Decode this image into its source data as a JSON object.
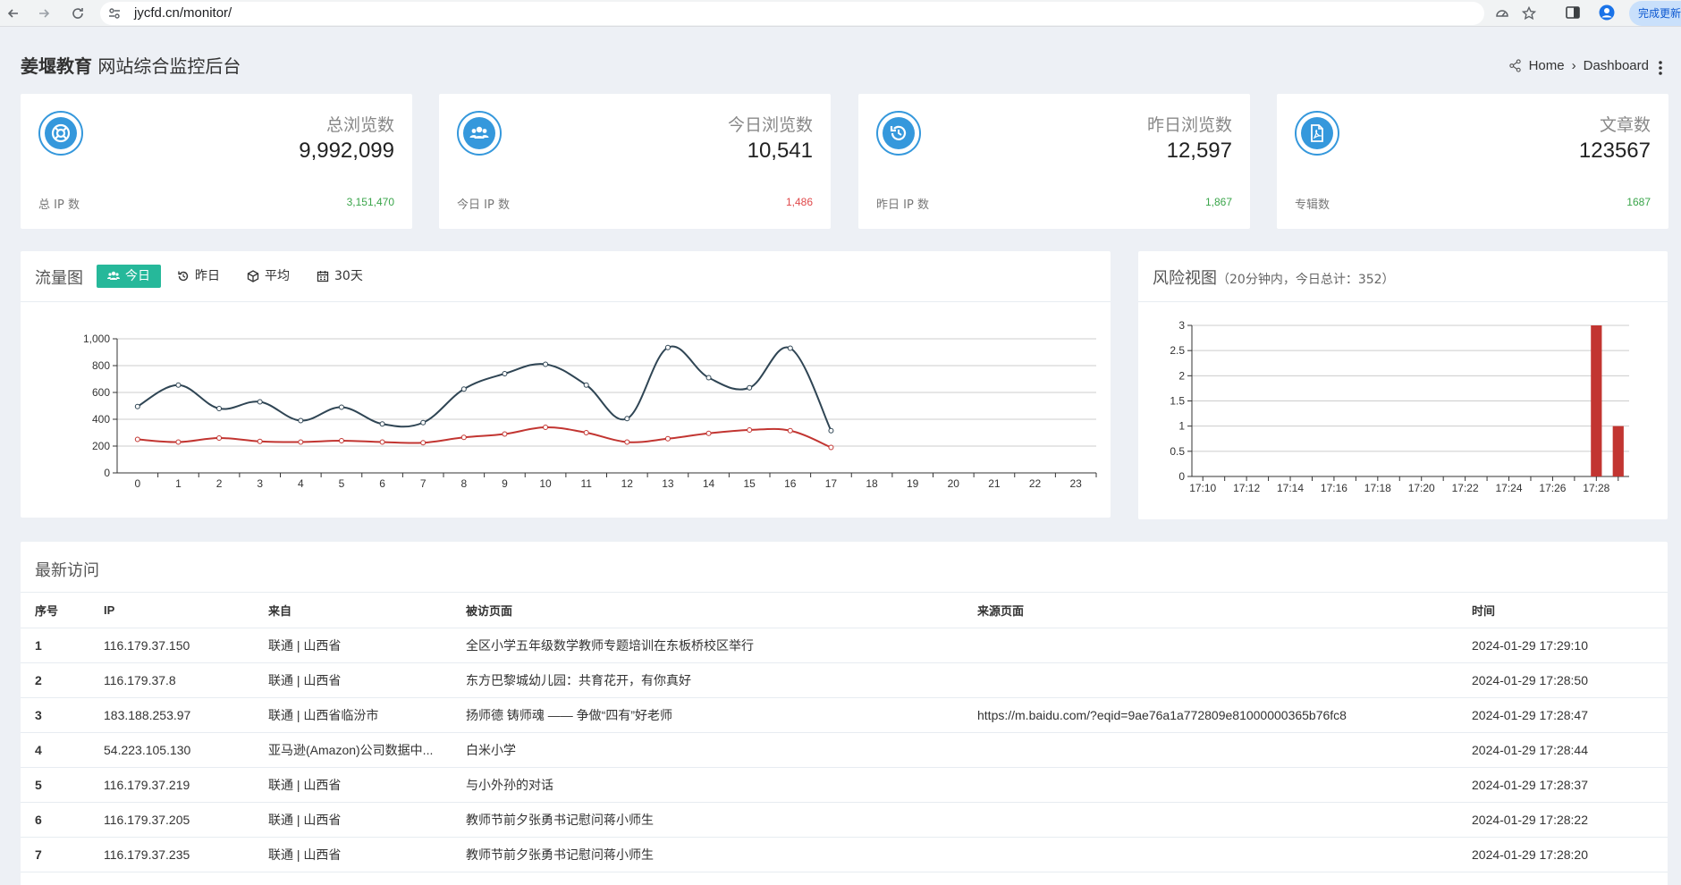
{
  "browser": {
    "url": "jycfd.cn/monitor/",
    "update_label": "完成更新"
  },
  "header": {
    "title_bold": "姜堰教育",
    "title_rest": " 网站综合监控后台",
    "breadcrumb": [
      "Home",
      "Dashboard"
    ]
  },
  "stats": [
    {
      "icon": "lifebuoy-icon",
      "label": "总浏览数",
      "value": "9,992,099",
      "sub_label": "总 IP 数",
      "sub_value": "3,151,470",
      "sub_color": "#3aa54a"
    },
    {
      "icon": "users-icon",
      "label": "今日浏览数",
      "value": "10,541",
      "sub_label": "今日 IP 数",
      "sub_value": "1,486",
      "sub_color": "#e0494b"
    },
    {
      "icon": "history-icon",
      "label": "昨日浏览数",
      "value": "12,597",
      "sub_label": "昨日 IP 数",
      "sub_value": "1,867",
      "sub_color": "#3aa54a"
    },
    {
      "icon": "pdf-file-icon",
      "label": "文章数",
      "value": "123567",
      "sub_label": "专辑数",
      "sub_value": "1687",
      "sub_color": "#3aa54a"
    }
  ],
  "traffic": {
    "title": "流量图",
    "tabs": [
      {
        "icon": "users-icon",
        "label": "今日",
        "active": true
      },
      {
        "icon": "history-icon",
        "label": "昨日",
        "active": false
      },
      {
        "icon": "cube-icon",
        "label": "平均",
        "active": false
      },
      {
        "icon": "calendar-icon",
        "label": "30天",
        "active": false
      }
    ]
  },
  "risk": {
    "title": "风险视图",
    "subtitle": "（20分钟内，今日总计：352）"
  },
  "chart_data": [
    {
      "type": "line",
      "x": [
        0,
        1,
        2,
        3,
        4,
        5,
        6,
        7,
        8,
        9,
        10,
        11,
        12,
        13,
        14,
        15,
        16,
        17,
        18,
        19,
        20,
        21,
        22,
        23
      ],
      "ylim": [
        0,
        1000
      ],
      "yticks": [
        "0",
        "200",
        "400",
        "600",
        "800",
        "1,000"
      ],
      "grid": true,
      "series": [
        {
          "color": "#2f4554",
          "values": [
            495,
            655,
            480,
            530,
            390,
            490,
            365,
            375,
            625,
            740,
            810,
            655,
            405,
            935,
            710,
            635,
            930,
            315
          ]
        },
        {
          "color": "#c23531",
          "values": [
            250,
            230,
            260,
            235,
            230,
            240,
            230,
            225,
            265,
            290,
            340,
            300,
            230,
            255,
            295,
            320,
            315,
            190
          ]
        }
      ]
    },
    {
      "type": "bar",
      "categories": [
        "17:10",
        "17:11",
        "17:12",
        "17:13",
        "17:14",
        "17:15",
        "17:16",
        "17:17",
        "17:18",
        "17:19",
        "17:20",
        "17:21",
        "17:22",
        "17:23",
        "17:24",
        "17:25",
        "17:26",
        "17:27",
        "17:28",
        "17:29"
      ],
      "xticks": [
        "17:10",
        "17:12",
        "17:14",
        "17:16",
        "17:18",
        "17:20",
        "17:22",
        "17:24",
        "17:26",
        "17:28"
      ],
      "values": [
        0,
        0,
        0,
        0,
        0,
        0,
        0,
        0,
        0,
        0,
        0,
        0,
        0,
        0,
        0,
        0,
        0,
        0,
        3,
        1
      ],
      "ylim": [
        0,
        3
      ],
      "yticks": [
        "0",
        "0.5",
        "1",
        "1.5",
        "2",
        "2.5",
        "3"
      ],
      "color": "#c23531",
      "grid": true
    }
  ],
  "visits": {
    "title": "最新访问",
    "columns": [
      "序号",
      "IP",
      "来自",
      "被访页面",
      "来源页面",
      "时间"
    ],
    "rows": [
      [
        "1",
        "116.179.37.150",
        "联通 | 山西省",
        "全区小学五年级数学教师专题培训在东板桥校区举行",
        "",
        "2024-01-29 17:29:10"
      ],
      [
        "2",
        "116.179.37.8",
        "联通 | 山西省",
        "东方巴黎城幼儿园：共育花开，有你真好",
        "",
        "2024-01-29 17:28:50"
      ],
      [
        "3",
        "183.188.253.97",
        "联通 | 山西省临汾市",
        "扬师德 铸师魂 —— 争做“四有”好老师",
        "https://m.baidu.com/?eqid=9ae76a1a772809e81000000365b76fc8",
        "2024-01-29 17:28:47"
      ],
      [
        "4",
        "54.223.105.130",
        "亚马逊(Amazon)公司数据中...",
        "白米小学",
        "",
        "2024-01-29 17:28:44"
      ],
      [
        "5",
        "116.179.37.219",
        "联通 | 山西省",
        "与小外孙的对话",
        "",
        "2024-01-29 17:28:37"
      ],
      [
        "6",
        "116.179.37.205",
        "联通 | 山西省",
        "教师节前夕张勇书记慰问蒋小师生",
        "",
        "2024-01-29 17:28:22"
      ],
      [
        "7",
        "116.179.37.235",
        "联通 | 山西省",
        "教师节前夕张勇书记慰问蒋小师生",
        "",
        "2024-01-29 17:28:20"
      ]
    ]
  }
}
